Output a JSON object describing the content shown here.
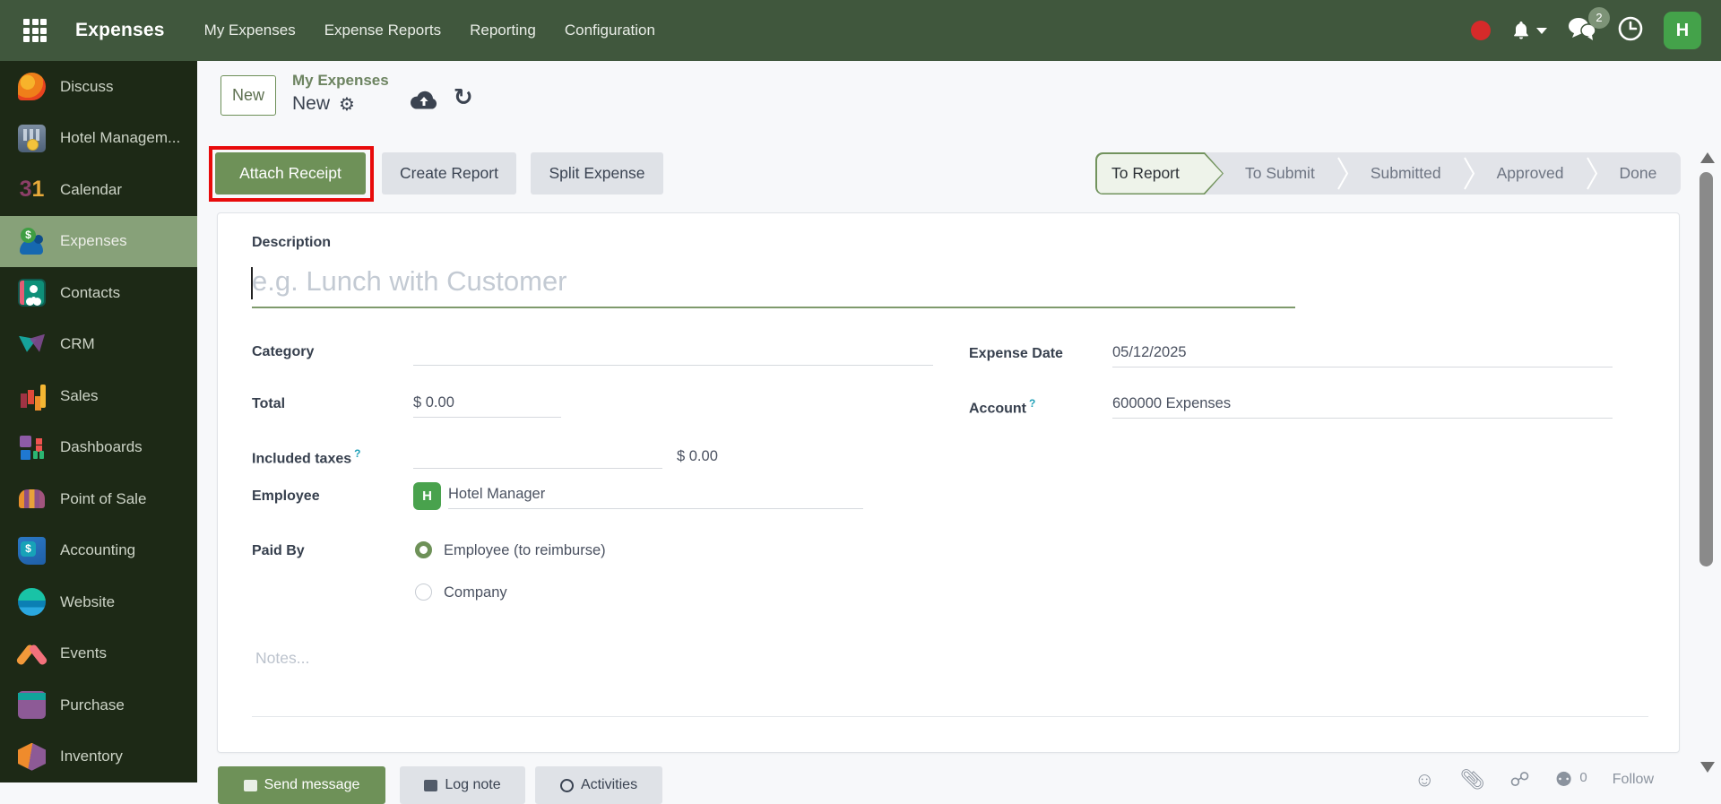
{
  "navbar": {
    "brand": "Expenses",
    "menu": [
      "My Expenses",
      "Expense Reports",
      "Reporting",
      "Configuration"
    ],
    "message_badge": "2",
    "avatar_initial": "H"
  },
  "sidebar": {
    "items": [
      {
        "label": "Discuss"
      },
      {
        "label": "Hotel Managem..."
      },
      {
        "label": "Calendar"
      },
      {
        "label": "Expenses",
        "selected": true
      },
      {
        "label": "Contacts"
      },
      {
        "label": "CRM"
      },
      {
        "label": "Sales"
      },
      {
        "label": "Dashboards"
      },
      {
        "label": "Point of Sale"
      },
      {
        "label": "Accounting"
      },
      {
        "label": "Website"
      },
      {
        "label": "Events"
      },
      {
        "label": "Purchase"
      },
      {
        "label": "Inventory"
      }
    ]
  },
  "control_panel": {
    "new_button": "New",
    "breadcrumb_parent": "My Expenses",
    "breadcrumb_current": "New"
  },
  "actions": {
    "attach_receipt": "Attach Receipt",
    "create_report": "Create Report",
    "split_expense": "Split Expense"
  },
  "statusbar": {
    "active": "To Report",
    "stages": [
      "To Report",
      "To Submit",
      "Submitted",
      "Approved",
      "Done"
    ]
  },
  "form": {
    "description_label": "Description",
    "description_placeholder": "e.g. Lunch with Customer",
    "category_label": "Category",
    "category_value": "",
    "total_label": "Total",
    "total_value": "$ 0.00",
    "included_taxes_label": "Included taxes",
    "included_taxes_value": "",
    "included_taxes_amount": "$ 0.00",
    "employee_label": "Employee",
    "employee_value": "Hotel Manager",
    "employee_avatar_initial": "H",
    "paid_by_label": "Paid By",
    "paid_by_options": [
      {
        "label": "Employee (to reimburse)",
        "selected": true
      },
      {
        "label": "Company",
        "selected": false
      }
    ],
    "expense_date_label": "Expense Date",
    "expense_date_value": "05/12/2025",
    "account_label": "Account",
    "account_value": "600000 Expenses",
    "notes_placeholder": "Notes..."
  },
  "chatter": {
    "send_message": "Send message",
    "log_note": "Log note",
    "activities": "Activities",
    "attachment_count": "0",
    "follow": "Follow"
  },
  "colors": {
    "navbar_bg": "#40573d",
    "sidebar_bg": "#1d2916",
    "accent_green": "#6e9158",
    "annotation_red": "#e80b0b",
    "stage_active_bg": "#eef3ea"
  }
}
